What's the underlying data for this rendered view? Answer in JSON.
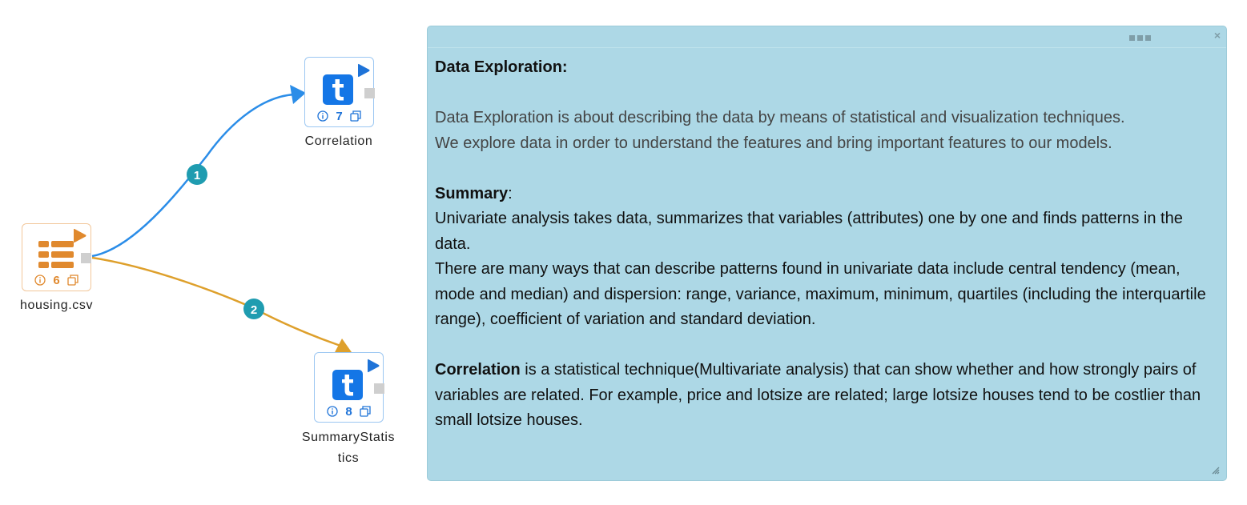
{
  "workflow": {
    "nodes": [
      {
        "id": "correlation",
        "label": "Correlation",
        "count": "7",
        "icon": "table-t-icon",
        "color": "#1e73d8"
      },
      {
        "id": "summary",
        "label_line1": "SummaryStatis",
        "label_line2": "tics",
        "count": "8",
        "icon": "table-t-icon",
        "color": "#1e73d8"
      },
      {
        "id": "housing",
        "label": "housing.csv",
        "count": "6",
        "icon": "csv-file-icon",
        "color": "#e0892e"
      }
    ],
    "edges": [
      {
        "from": "housing",
        "to": "correlation",
        "badge": "1",
        "color": "#2b8de8"
      },
      {
        "from": "housing",
        "to": "summary",
        "badge": "2",
        "color": "#dea02c"
      }
    ],
    "badge_color": "#1f9cb0"
  },
  "note": {
    "title": "Data Exploration:",
    "intro_line1": "Data Exploration is about describing the data by means of statistical and visualization techniques.",
    "intro_line2": "We explore data in order to understand the features and bring important features to our models.",
    "summary_heading": "Summary",
    "summary_colon": ":",
    "summary_p1": "Univariate analysis takes data, summarizes that variables (attributes) one by one and finds patterns in the data.",
    "summary_p2": "There are many ways that can describe patterns found in univariate data include central tendency (mean, mode and median) and dispersion: range, variance, maximum, minimum, quartiles (including the interquartile range), coefficient of variation and standard deviation.",
    "correlation_heading": "Correlation",
    "correlation_text": " is a statistical technique(Multivariate analysis) that can show whether and how strongly pairs of variables are related. For example, price and lotsize are related; large lotsize houses tend to be costlier than small lotsize houses.",
    "background": "#add8e6",
    "close_glyph": "×"
  }
}
